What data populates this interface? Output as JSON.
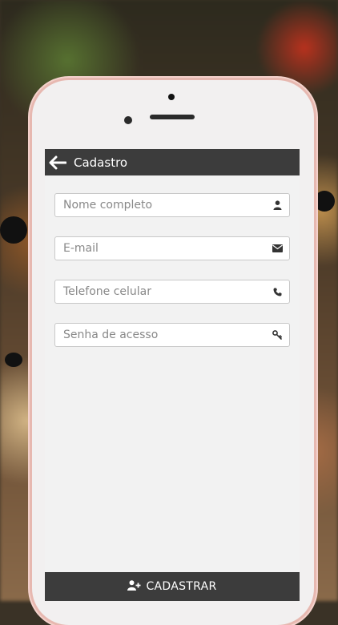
{
  "header": {
    "title": "Cadastro",
    "back_icon": "arrow-left-icon"
  },
  "form": {
    "fields": [
      {
        "placeholder": "Nome completo",
        "icon": "user-icon"
      },
      {
        "placeholder": "E-mail",
        "icon": "envelope-icon"
      },
      {
        "placeholder": "Telefone celular",
        "icon": "phone-icon"
      },
      {
        "placeholder": "Senha de acesso",
        "icon": "key-icon"
      }
    ]
  },
  "footer": {
    "submit_label": "CADASTRAR",
    "submit_icon": "user-plus-icon"
  },
  "colors": {
    "bar": "#3c3c3c",
    "screen": "#f2f2f2",
    "phone_frame": "#e7b8b0"
  }
}
